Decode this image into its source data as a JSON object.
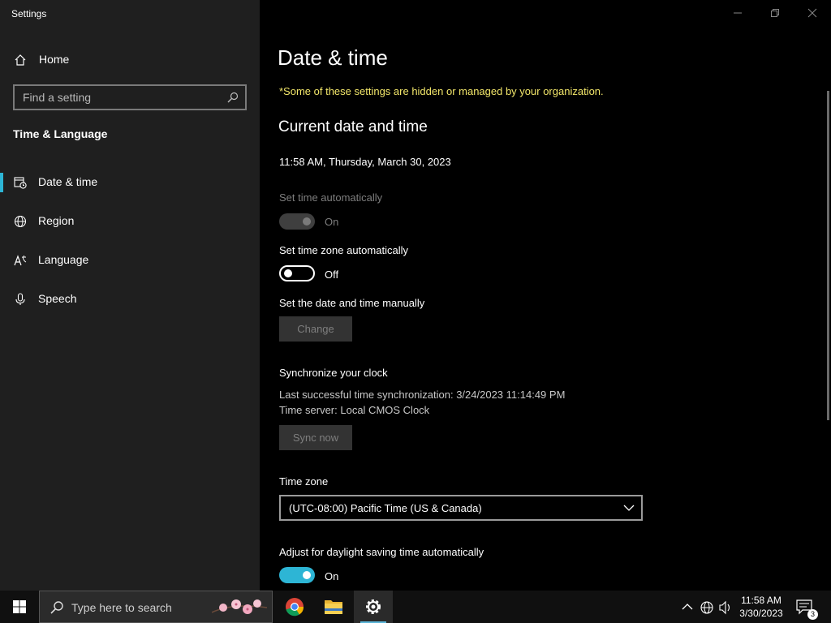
{
  "window": {
    "title": "Settings"
  },
  "sidebar": {
    "home_label": "Home",
    "search_placeholder": "Find a setting",
    "section_title": "Time & Language",
    "items": [
      {
        "label": "Date & time",
        "icon": "date-time-icon",
        "active": true
      },
      {
        "label": "Region",
        "icon": "globe-icon",
        "active": false
      },
      {
        "label": "Language",
        "icon": "language-icon",
        "active": false
      },
      {
        "label": "Speech",
        "icon": "microphone-icon",
        "active": false
      }
    ]
  },
  "main": {
    "title": "Date & time",
    "org_notice": "*Some of these settings are hidden or managed by your organization.",
    "current_header": "Current date and time",
    "current_datetime": "11:58 AM, Thursday, March 30, 2023",
    "set_time_auto": {
      "label": "Set time automatically",
      "state": "On",
      "enabled": false
    },
    "set_tz_auto": {
      "label": "Set time zone automatically",
      "state": "Off",
      "enabled": true
    },
    "manual": {
      "label": "Set the date and time manually",
      "button": "Change"
    },
    "sync": {
      "header": "Synchronize your clock",
      "last_sync": "Last successful time synchronization: 3/24/2023 11:14:49 PM",
      "server": "Time server: Local CMOS Clock",
      "button": "Sync now"
    },
    "timezone": {
      "label": "Time zone",
      "value": "(UTC-08:00) Pacific Time (US & Canada)"
    },
    "dst": {
      "label": "Adjust for daylight saving time automatically",
      "state": "On"
    }
  },
  "taskbar": {
    "search_placeholder": "Type here to search",
    "clock_time": "11:58 AM",
    "clock_date": "3/30/2023",
    "notification_count": "3",
    "pinned": [
      "chrome-icon",
      "file-explorer-icon",
      "settings-gear-icon"
    ]
  },
  "colors": {
    "accent": "#2db5d5",
    "notice": "#f2e66a",
    "sidebar_bg": "#1f1f1f"
  }
}
